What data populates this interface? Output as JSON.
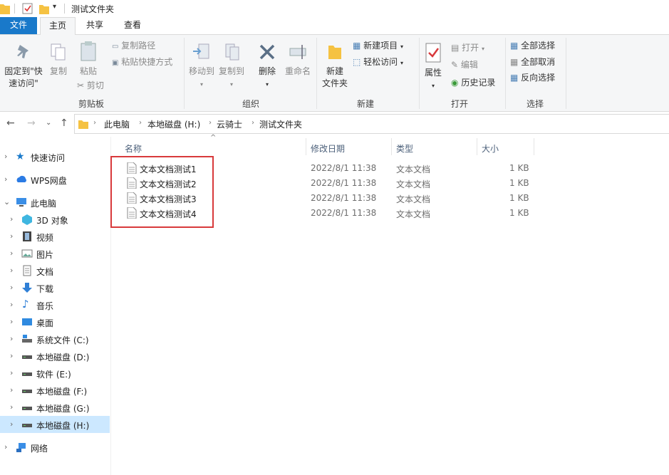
{
  "window": {
    "title": "测试文件夹"
  },
  "tabs": {
    "file": "文件",
    "home": "主页",
    "share": "共享",
    "view": "查看"
  },
  "ribbon": {
    "clipboard": {
      "group": "剪贴板",
      "pin_line1": "固定到\"快",
      "pin_line2": "速访问\"",
      "copy": "复制",
      "paste": "粘贴",
      "copy_path": "复制路径",
      "paste_shortcut": "粘贴快捷方式",
      "cut": "剪切"
    },
    "organize": {
      "group": "组织",
      "move_to": "移动到",
      "copy_to": "复制到",
      "delete": "删除",
      "rename": "重命名"
    },
    "new": {
      "group": "新建",
      "new_folder_line1": "新建",
      "new_folder_line2": "文件夹",
      "new_item": "新建项目",
      "easy_access": "轻松访问"
    },
    "open": {
      "group": "打开",
      "properties": "属性",
      "open": "打开",
      "edit": "编辑",
      "history": "历史记录"
    },
    "select": {
      "group": "选择",
      "select_all": "全部选择",
      "select_none": "全部取消",
      "invert": "反向选择"
    }
  },
  "address": {
    "crumbs": [
      "此电脑",
      "本地磁盘 (H:)",
      "云骑士",
      "测试文件夹"
    ]
  },
  "sidebar": {
    "items": [
      {
        "label": "快速访问"
      },
      {
        "label": "WPS网盘"
      },
      {
        "label": "此电脑"
      },
      {
        "label": "3D 对象"
      },
      {
        "label": "视频"
      },
      {
        "label": "图片"
      },
      {
        "label": "文档"
      },
      {
        "label": "下载"
      },
      {
        "label": "音乐"
      },
      {
        "label": "桌面"
      },
      {
        "label": "系统文件 (C:)"
      },
      {
        "label": "本地磁盘 (D:)"
      },
      {
        "label": "软件 (E:)"
      },
      {
        "label": "本地磁盘 (F:)"
      },
      {
        "label": "本地磁盘 (G:)"
      },
      {
        "label": "本地磁盘 (H:)"
      },
      {
        "label": "网络"
      }
    ]
  },
  "files": {
    "columns": {
      "name": "名称",
      "modified": "修改日期",
      "type": "类型",
      "size": "大小"
    },
    "rows": [
      {
        "name": "文本文档测试1",
        "modified": "2022/8/1 11:38",
        "type": "文本文档",
        "size": "1 KB"
      },
      {
        "name": "文本文档测试2",
        "modified": "2022/8/1 11:38",
        "type": "文本文档",
        "size": "1 KB"
      },
      {
        "name": "文本文档测试3",
        "modified": "2022/8/1 11:38",
        "type": "文本文档",
        "size": "1 KB"
      },
      {
        "name": "文本文档测试4",
        "modified": "2022/8/1 11:38",
        "type": "文本文档",
        "size": "1 KB"
      }
    ]
  },
  "colors": {
    "accent": "#1979ca",
    "selection": "#cce8ff",
    "highlight": "#d8393b",
    "folder": "#f5c242"
  }
}
